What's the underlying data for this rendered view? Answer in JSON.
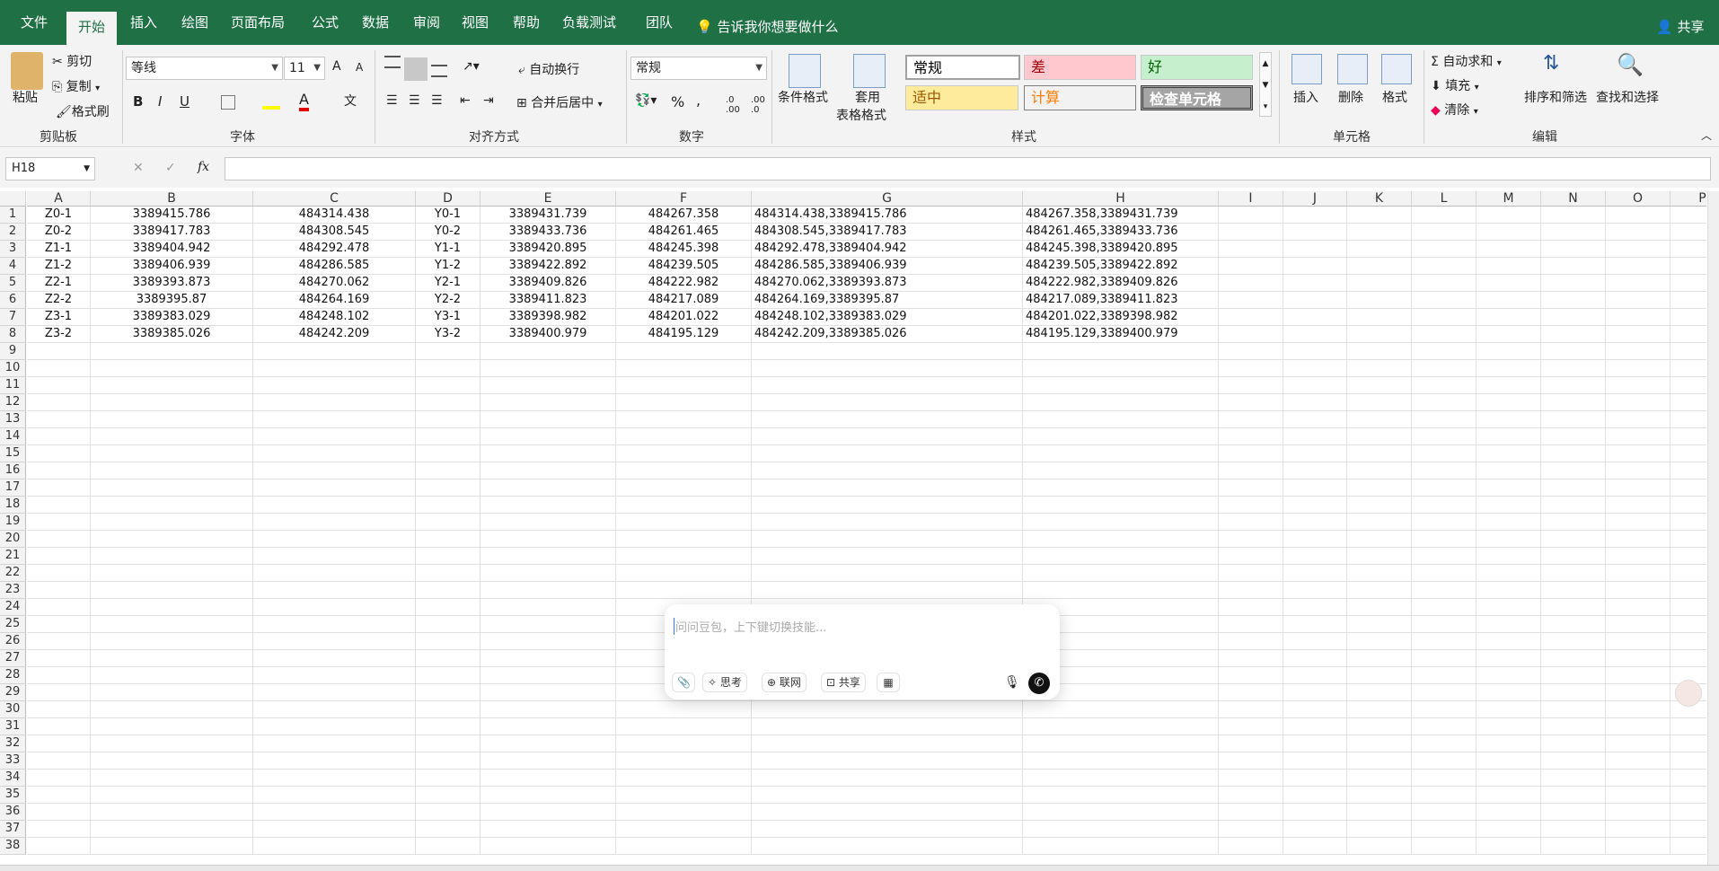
{
  "tabs": [
    "文件",
    "开始",
    "插入",
    "绘图",
    "页面布局",
    "公式",
    "数据",
    "审阅",
    "视图",
    "帮助",
    "负载测试",
    "团队"
  ],
  "tell_me": "告诉我你想要做什么",
  "share": "共享",
  "ribbon": {
    "clipboard": {
      "paste": "粘贴",
      "cut": "剪切",
      "copy": "复制",
      "format_painter": "格式刷",
      "label": "剪贴板"
    },
    "font": {
      "name": "等线",
      "size": "11",
      "label": "字体",
      "bold": "B",
      "italic": "I",
      "underline": "U",
      "grow": "A",
      "shrink": "A",
      "color_a": "A",
      "wen": "文"
    },
    "alignment": {
      "wrap": "自动换行",
      "merge": "合并后居中",
      "label": "对齐方式"
    },
    "number": {
      "format": "常规",
      "percent": "%",
      "comma": ",",
      "label": "数字"
    },
    "styles": {
      "cond_format": "条件格式",
      "table_format_1": "套用",
      "table_format_2": "表格格式",
      "label": "样式",
      "cells": [
        {
          "text": "常规"
        },
        {
          "text": "差"
        },
        {
          "text": "好"
        },
        {
          "text": "适中"
        },
        {
          "text": "计算"
        },
        {
          "text": "检查单元格"
        }
      ]
    },
    "cells": {
      "insert": "插入",
      "delete": "删除",
      "format": "格式",
      "label": "单元格"
    },
    "editing": {
      "autosum": "自动求和",
      "fill": "填充",
      "clear": "清除",
      "sort_filter": "排序和筛选",
      "find_select": "查找和选择",
      "label": "编辑"
    }
  },
  "namebox": "H18",
  "fx": "fx",
  "columns": [
    "A",
    "B",
    "C",
    "D",
    "E",
    "F",
    "G",
    "H",
    "I",
    "J",
    "K",
    "L",
    "M",
    "N",
    "O",
    "P"
  ],
  "rows": [
    [
      "Z0-1",
      "3389415.786",
      "484314.438",
      "Y0-1",
      "3389431.739",
      "484267.358",
      "484314.438,3389415.786",
      "484267.358,3389431.739"
    ],
    [
      "Z0-2",
      "3389417.783",
      "484308.545",
      "Y0-2",
      "3389433.736",
      "484261.465",
      "484308.545,3389417.783",
      "484261.465,3389433.736"
    ],
    [
      "Z1-1",
      "3389404.942",
      "484292.478",
      "Y1-1",
      "3389420.895",
      "484245.398",
      "484292.478,3389404.942",
      "484245.398,3389420.895"
    ],
    [
      "Z1-2",
      "3389406.939",
      "484286.585",
      "Y1-2",
      "3389422.892",
      "484239.505",
      "484286.585,3389406.939",
      "484239.505,3389422.892"
    ],
    [
      "Z2-1",
      "3389393.873",
      "484270.062",
      "Y2-1",
      "3389409.826",
      "484222.982",
      "484270.062,3389393.873",
      "484222.982,3389409.826"
    ],
    [
      "Z2-2",
      "3389395.87",
      "484264.169",
      "Y2-2",
      "3389411.823",
      "484217.089",
      "484264.169,3389395.87",
      "484217.089,3389411.823"
    ],
    [
      "Z3-1",
      "3389383.029",
      "484248.102",
      "Y3-1",
      "3389398.982",
      "484201.022",
      "484248.102,3389383.029",
      "484201.022,3389398.982"
    ],
    [
      "Z3-2",
      "3389385.026",
      "484242.209",
      "Y3-2",
      "3389400.979",
      "484195.129",
      "484242.209,3389385.026",
      "484195.129,3389400.979"
    ]
  ],
  "row_count": 38,
  "chat": {
    "placeholder": "问问豆包，上下键切换技能...",
    "chips": [
      "思考",
      "联网",
      "共享"
    ]
  }
}
